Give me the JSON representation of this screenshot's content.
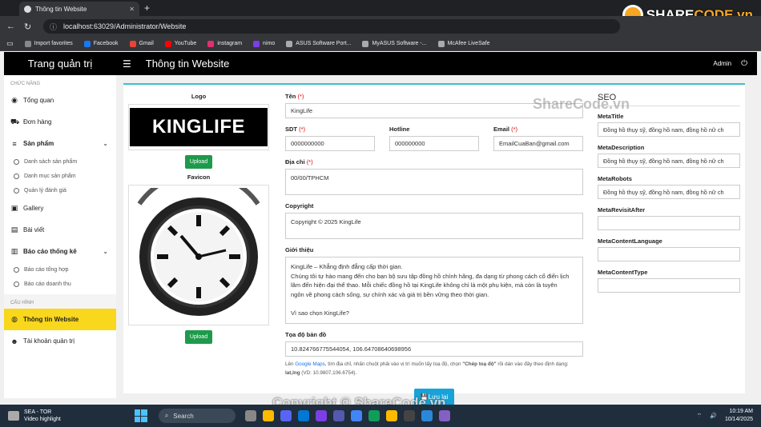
{
  "browser": {
    "tab_title": "Thông tin Website",
    "address": "localhost:63029/Administrator/Website",
    "bookmarks": [
      {
        "label": "Import favorites",
        "color": "#888"
      },
      {
        "label": "Facebook",
        "color": "#1877f2"
      },
      {
        "label": "Gmail",
        "color": "#ea4335"
      },
      {
        "label": "YouTube",
        "color": "#ff0000"
      },
      {
        "label": "instagram",
        "color": "#e1306c"
      },
      {
        "label": "nimo",
        "color": "#7b3fe4"
      },
      {
        "label": "ASUS Software Port...",
        "color": "#aaa"
      },
      {
        "label": "MyASUS Software -...",
        "color": "#aaa"
      },
      {
        "label": "McAfee LiveSafe",
        "color": "#aaa"
      }
    ]
  },
  "watermark": {
    "logo_text": "SHARE",
    "logo_text2": "CODE.vn",
    "mid": "ShareCode.vn",
    "bottom": "Copyright © ShareCode.vn"
  },
  "header": {
    "brand": "Trang quản trị",
    "title": "Thông tin Website",
    "user": "Admin"
  },
  "sidebar": {
    "section1": "CHỨC NĂNG",
    "section2": "CẤU HÌNH",
    "items": {
      "overview": "Tổng quan",
      "orders": "Đơn hàng",
      "products": "Sản phẩm",
      "product_list": "Danh sách sản phẩm",
      "product_cat": "Danh mục sản phẩm",
      "reviews": "Quản lý đánh giá",
      "gallery": "Gallery",
      "posts": "Bài viết",
      "reports": "Báo cáo thống kê",
      "report_sum": "Báo cáo tổng hợp",
      "report_rev": "Báo cáo doanh thu",
      "website": "Thông tin Website",
      "accounts": "Tài khoản quản trị"
    }
  },
  "form": {
    "logo_label": "Logo",
    "logo_text": "KINGLIFE",
    "upload": "Upload",
    "favicon_label": "Favicon",
    "name_label": "Tên",
    "name_value": "KingLife",
    "req": "(*)",
    "phone_label": "SDT",
    "phone_value": "0000000000",
    "hotline_label": "Hotline",
    "hotline_value": "000000000",
    "email_label": "Email",
    "email_value": "EmailCuaBan@gmail.com",
    "address_label": "Địa chỉ",
    "address_value": "00/00/TPHCM",
    "copyright_label": "Copyright",
    "copyright_value": "Copyright © 2025 KingLife",
    "intro_label": "Giới thiệu",
    "intro_lines": [
      "KingLife – Khẳng định đẳng cấp thời gian.",
      "Chúng tôi tự hào mang đến cho bạn bộ sưu tập đồng hồ chính hãng, đa dạng từ phong cách cổ điển lịch lãm đến hiện đại thể thao. Mỗi chiếc đồng hồ tại KingLife không chỉ là một phụ kiện, mà còn là tuyên ngôn về phong cách sống, sự chính xác và giá trị bền vững theo thời gian.",
      "",
      "Vì sao chọn KingLife?"
    ],
    "map_label": "Tọa độ bản đồ",
    "map_value": "10.824766775544054, 106.64708640698956",
    "hint_a": "Lên ",
    "hint_link": "Google Maps",
    "hint_b": ", tìm địa chỉ, nhấn chuột phải vào vị trí muốn lấy toạ độ, chọn ",
    "hint_bold": "\"Chép toạ độ\"",
    "hint_c": " rồi dán vào đây theo định dạng: ",
    "hint_fmt": "lat,lng",
    "hint_d": " (VD: 10.9807,106.6754).",
    "save": "Lưu lại"
  },
  "seo": {
    "title": "SEO",
    "fields": [
      {
        "label": "MetaTitle",
        "value": "Đồng hồ thụy sỹ, đồng hồ nam, đồng hồ nữ ch"
      },
      {
        "label": "MetaDescription",
        "value": "Đồng hồ thụy sỹ, đồng hồ nam, đồng hồ nữ ch"
      },
      {
        "label": "MetaRobots",
        "value": "Đồng hồ thụy sỹ, đồng hồ nam, đồng hồ nữ ch"
      },
      {
        "label": "MetaRevisitAfter",
        "value": ""
      },
      {
        "label": "MetaContentLanguage",
        "value": ""
      },
      {
        "label": "MetaContentType",
        "value": ""
      }
    ]
  },
  "taskbar": {
    "news_title": "SEA - TOR",
    "news_sub": "Video highlight",
    "search": "Search",
    "time": "10:19 AM",
    "date": "10/14/2025"
  }
}
